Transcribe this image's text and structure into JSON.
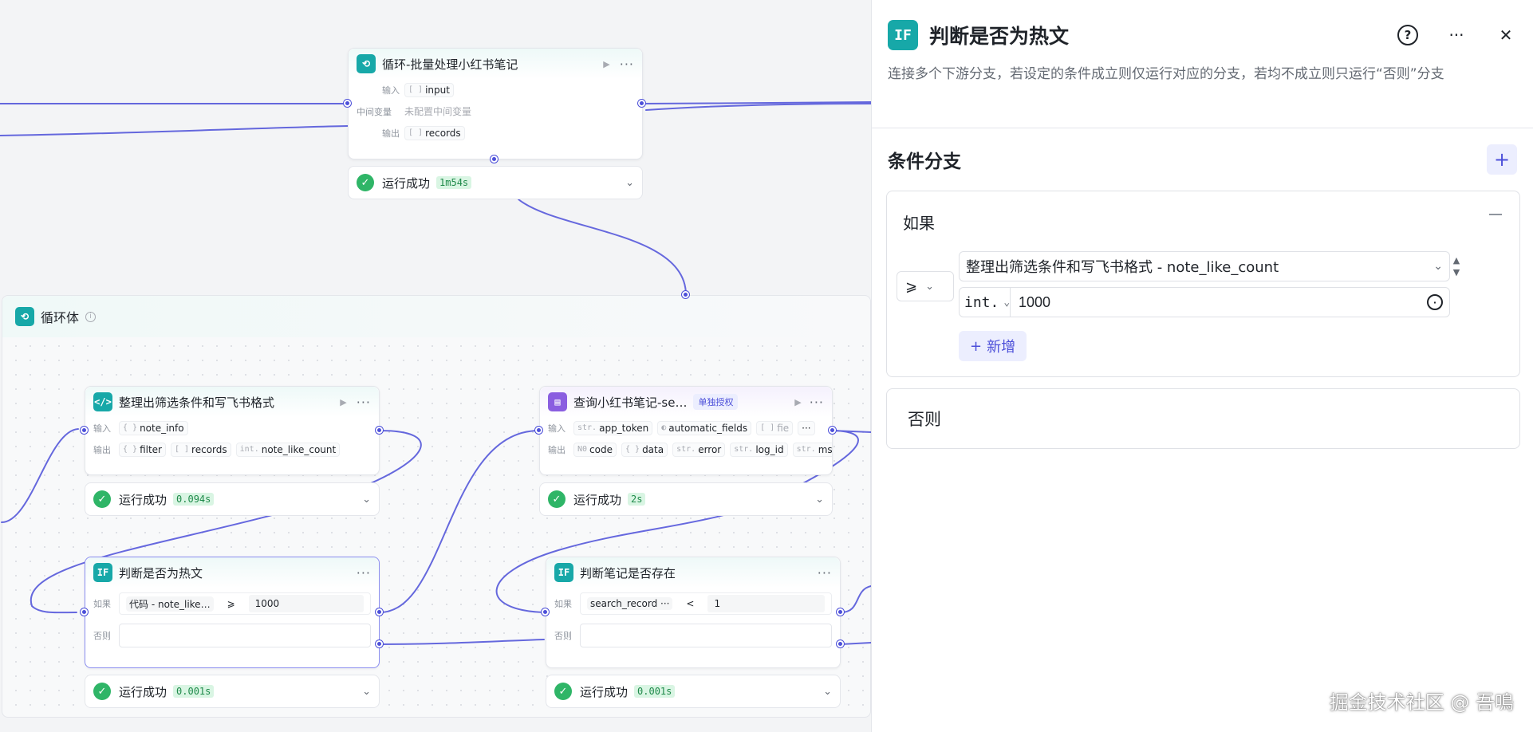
{
  "colors": {
    "accent": "#4c4fd9",
    "teal": "#17a8a8",
    "purple": "#8a5ee0",
    "success": "#2fb567"
  },
  "canvas": {
    "loop_node": {
      "title": "循环-批量处理小红书笔记",
      "input_label": "输入",
      "input_tag": "input",
      "mid_label": "中间变量",
      "mid_value": "未配置中间变量",
      "output_label": "输出",
      "output_tag": "records",
      "status": "运行成功",
      "time": "1m54s"
    },
    "loop_body": {
      "title": "循环体"
    },
    "code_node": {
      "title": "整理出筛选条件和写飞书格式",
      "input_label": "输入",
      "input_tag": "note_info",
      "output_label": "输出",
      "output_tags": [
        "filter",
        "records",
        "note_like_count"
      ],
      "output_types": [
        "{ }",
        "[ ]",
        "int."
      ],
      "status": "运行成功",
      "time": "0.094s"
    },
    "query_node": {
      "title": "查询小红书笔记-se…",
      "auth_badge": "单独授权",
      "input_label": "输入",
      "input_tags": [
        "app_token",
        "automatic_fields",
        "fie"
      ],
      "input_types": [
        "str.",
        "◐",
        "[ ]"
      ],
      "output_label": "输出",
      "output_tags": [
        "code",
        "data",
        "error",
        "log_id",
        "msg"
      ],
      "output_types": [
        "N0",
        "{ }",
        "str.",
        "str.",
        "str."
      ],
      "status": "运行成功",
      "time": "2s"
    },
    "if_node": {
      "title": "判断是否为热文",
      "if_label": "如果",
      "left": "代码 - note_like…",
      "op": "⩾",
      "right": "1000",
      "else_label": "否则",
      "status": "运行成功",
      "time": "0.001s"
    },
    "exists_node": {
      "title": "判断笔记是否存在",
      "if_label": "如果",
      "left": "search_record ···",
      "op": "<",
      "right": "1",
      "else_label": "否则",
      "status": "运行成功",
      "time": "0.001s"
    }
  },
  "panel": {
    "icon": "IF",
    "title": "判断是否为热文",
    "description": "连接多个下游分支，若设定的条件成立则仅运行对应的分支，若均不成立则只运行“否则”分支",
    "section_title": "条件分支",
    "if_label": "如果",
    "operator": "⩾",
    "left_value": "整理出筛选条件和写飞书格式 - note_like_count",
    "right_type": "int.",
    "right_value": "1000",
    "new_label": "新增",
    "else_label": "否则"
  },
  "watermark": "掘金技术社区 @ 吾鳴"
}
